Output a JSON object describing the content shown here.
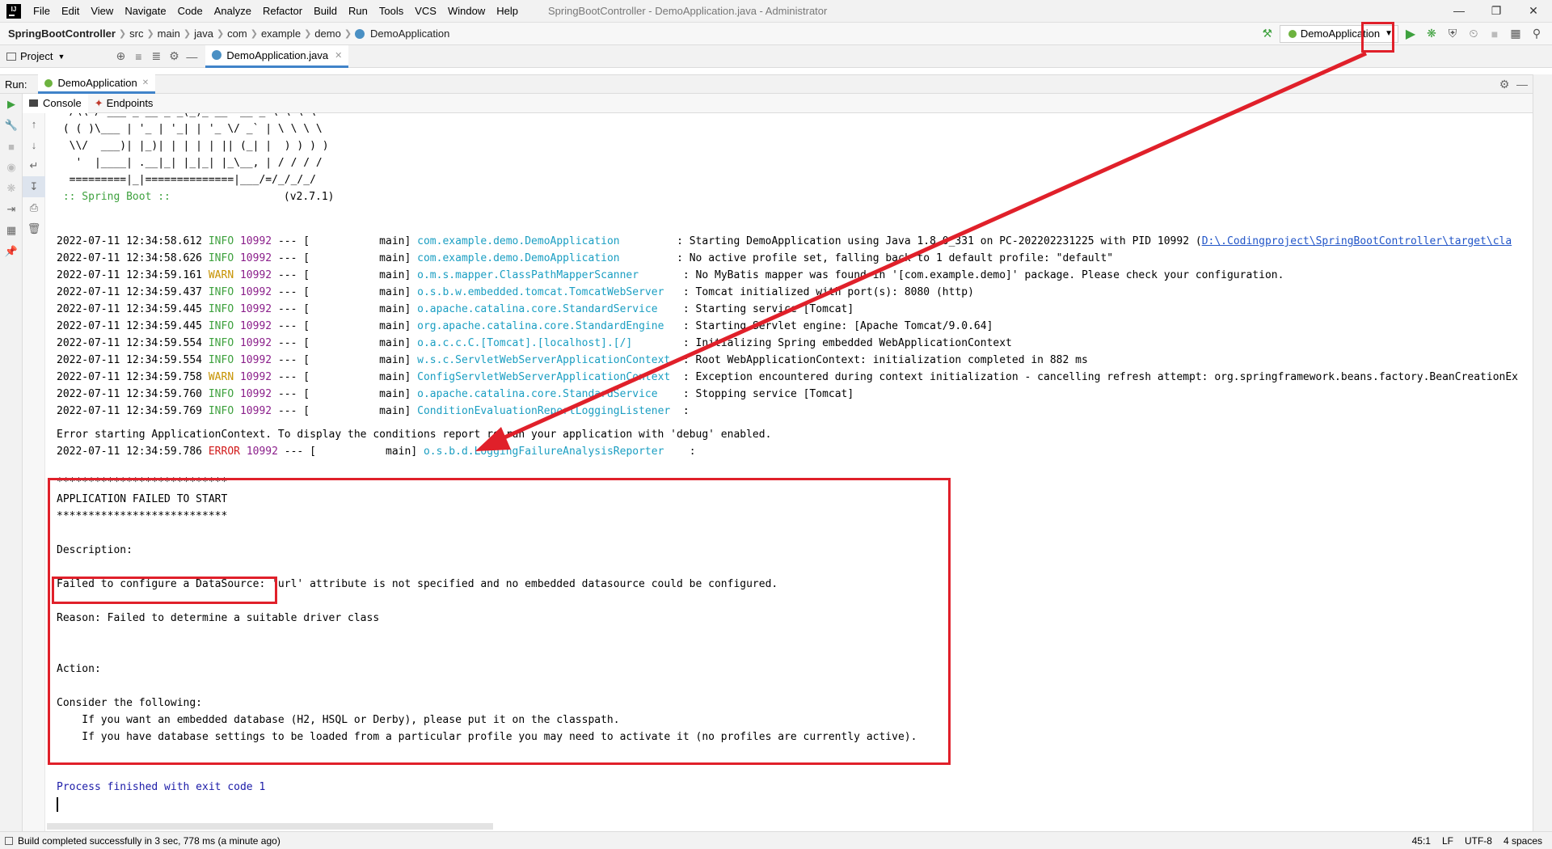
{
  "titlebar": {
    "menus": [
      "File",
      "Edit",
      "View",
      "Navigate",
      "Code",
      "Analyze",
      "Refactor",
      "Build",
      "Run",
      "Tools",
      "VCS",
      "Window",
      "Help"
    ],
    "title": "SpringBootController - DemoApplication.java - Administrator",
    "app_logo": "IJ"
  },
  "navbar": {
    "project": "SpringBootController",
    "crumbs": [
      "src",
      "main",
      "java",
      "com",
      "example",
      "demo"
    ],
    "file": "DemoApplication",
    "run_config": "DemoApplication"
  },
  "tabbar": {
    "project_label": "Project",
    "editor_tab": "DemoApplication.java"
  },
  "runbar": {
    "run_label": "Run:",
    "run_tab": "DemoApplication",
    "console_tab": "Console",
    "endpoints_tab": "Endpoints"
  },
  "console": {
    "banner": [
      "  /\\\\ / ___'_ __ _ _(_)_ __  __ _ \\ \\ \\ \\",
      " ( ( )\\___ | '_ | '_| | '_ \\/ _` | \\ \\ \\ \\",
      "  \\\\/  ___)| |_)| | | | | || (_| |  ) ) ) )",
      "   '  |____| .__|_| |_|_| |_\\__, | / / / /",
      "  =========|_|==============|___/=/_/_/_/"
    ],
    "spring_boot": " :: Spring Boot ::",
    "version": "(v2.7.1)",
    "logs": [
      {
        "ts": "2022-07-11 12:34:58.612",
        "level": "INFO",
        "pid": "10992",
        "thread": "--- [           main]",
        "logger": "com.example.demo.DemoApplication        ",
        "msg": ": Starting DemoApplication using Java 1.8.0_331 on PC-202202231225 with PID 10992 (",
        "link": "D:\\.Codingproject\\SpringBootController\\target\\cla"
      },
      {
        "ts": "2022-07-11 12:34:58.626",
        "level": "INFO",
        "pid": "10992",
        "thread": "--- [           main]",
        "logger": "com.example.demo.DemoApplication        ",
        "msg": ": No active profile set, falling back to 1 default profile: \"default\"",
        "link": ""
      },
      {
        "ts": "2022-07-11 12:34:59.161",
        "level": "WARN",
        "pid": "10992",
        "thread": "--- [           main]",
        "logger": "o.m.s.mapper.ClassPathMapperScanner      ",
        "msg": ": No MyBatis mapper was found in '[com.example.demo]' package. Please check your configuration.",
        "link": ""
      },
      {
        "ts": "2022-07-11 12:34:59.437",
        "level": "INFO",
        "pid": "10992",
        "thread": "--- [           main]",
        "logger": "o.s.b.w.embedded.tomcat.TomcatWebServer  ",
        "msg": ": Tomcat initialized with port(s): 8080 (http)",
        "link": ""
      },
      {
        "ts": "2022-07-11 12:34:59.445",
        "level": "INFO",
        "pid": "10992",
        "thread": "--- [           main]",
        "logger": "o.apache.catalina.core.StandardService   ",
        "msg": ": Starting service [Tomcat]",
        "link": ""
      },
      {
        "ts": "2022-07-11 12:34:59.445",
        "level": "INFO",
        "pid": "10992",
        "thread": "--- [           main]",
        "logger": "org.apache.catalina.core.StandardEngine  ",
        "msg": ": Starting Servlet engine: [Apache Tomcat/9.0.64]",
        "link": ""
      },
      {
        "ts": "2022-07-11 12:34:59.554",
        "level": "INFO",
        "pid": "10992",
        "thread": "--- [           main]",
        "logger": "o.a.c.c.C.[Tomcat].[localhost].[/]       ",
        "msg": ": Initializing Spring embedded WebApplicationContext",
        "link": ""
      },
      {
        "ts": "2022-07-11 12:34:59.554",
        "level": "INFO",
        "pid": "10992",
        "thread": "--- [           main]",
        "logger": "w.s.c.ServletWebServerApplicationContext ",
        "msg": ": Root WebApplicationContext: initialization completed in 882 ms",
        "link": ""
      },
      {
        "ts": "2022-07-11 12:34:59.758",
        "level": "WARN",
        "pid": "10992",
        "thread": "--- [           main]",
        "logger": "ConfigServletWebServerApplicationContext ",
        "msg": ": Exception encountered during context initialization - cancelling refresh attempt: org.springframework.beans.factory.BeanCreationEx",
        "link": ""
      },
      {
        "ts": "2022-07-11 12:34:59.760",
        "level": "INFO",
        "pid": "10992",
        "thread": "--- [           main]",
        "logger": "o.apache.catalina.core.StandardService   ",
        "msg": ": Stopping service [Tomcat]",
        "link": ""
      },
      {
        "ts": "2022-07-11 12:34:59.769",
        "level": "INFO",
        "pid": "10992",
        "thread": "--- [           main]",
        "logger": "ConditionEvaluationReportLoggingListener ",
        "msg": ":",
        "link": ""
      }
    ],
    "error_context": "Error starting ApplicationContext. To display the conditions report re-run your application with 'debug' enabled.",
    "error_log": {
      "ts": "2022-07-11 12:34:59.786",
      "level": "ERROR",
      "pid": "10992",
      "thread": "--- [           main]",
      "logger": "o.s.b.d.LoggingFailureAnalysisReporter   ",
      "msg": ":"
    },
    "stars": "***************************",
    "failed_title": "APPLICATION FAILED TO START",
    "description_label": "Description:",
    "failed_config": "Failed to configure a DataSource:",
    "failed_rest": " 'url' attribute is not specified and no embedded datasource could be configured.",
    "reason": "Reason: Failed to determine a suitable driver class",
    "action_label": "Action:",
    "consider": "Consider the following:",
    "suggest1": "    If you want an embedded database (H2, HSQL or Derby), please put it on the classpath.",
    "suggest2": "    If you have database settings to be loaded from a particular profile you may need to activate it (no profiles are currently active).",
    "exit": "Process finished with exit code 1"
  },
  "statusbar": {
    "message": "Build completed successfully in 3 sec, 778 ms (a minute ago)",
    "position": "45:1",
    "line_sep": "LF",
    "encoding": "UTF-8",
    "indent": "4 spaces"
  },
  "colors": {
    "annotation": "#e0202a",
    "run_green": "#3ea13e",
    "logger_teal": "#1a9ec2"
  }
}
